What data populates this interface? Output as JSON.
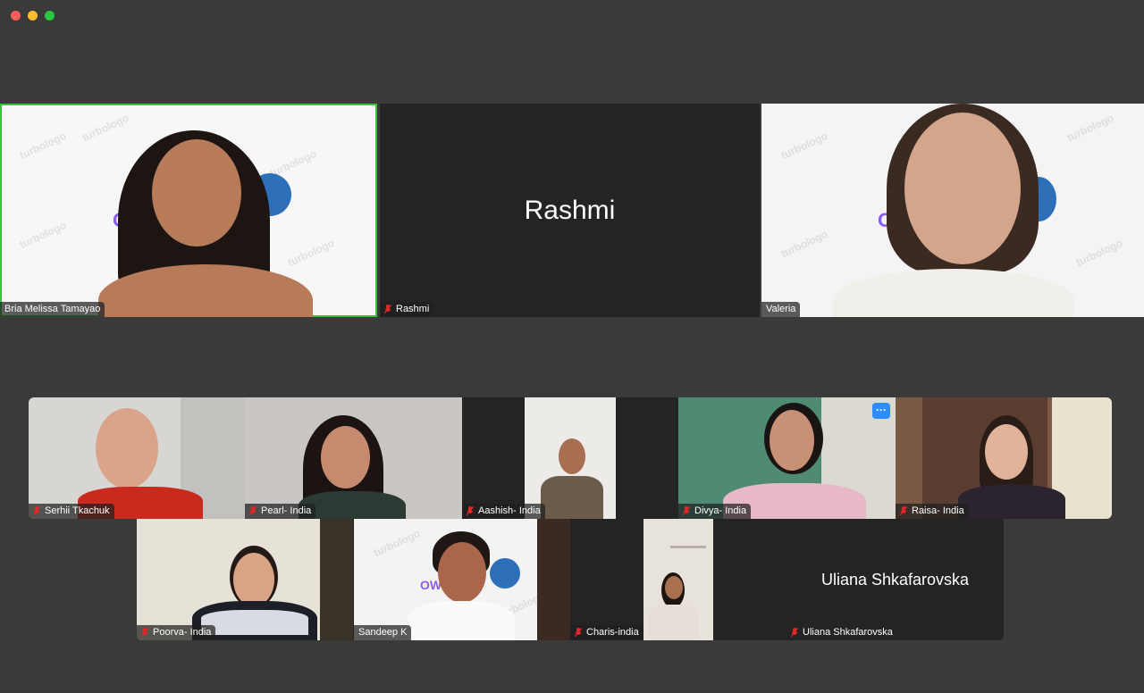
{
  "window": {
    "controls": {
      "close_color": "#ff5f57",
      "minimize_color": "#febc2e",
      "maximize_color": "#28c840"
    }
  },
  "top_row": [
    {
      "name": "Bria Melissa Tamayao",
      "muted": false,
      "speaking": true
    },
    {
      "name": "Rashmi",
      "muted": true,
      "camera_off": true,
      "display_name": "Rashmi"
    },
    {
      "name": "Valeria",
      "muted": false
    }
  ],
  "gallery_row1": [
    {
      "name": "Serhii Tkachuk",
      "muted": true
    },
    {
      "name": "Pearl- India",
      "muted": true
    },
    {
      "name": "Aashish- India",
      "muted": true
    },
    {
      "name": "Divya- India",
      "muted": true,
      "more_button": "···"
    },
    {
      "name": "Raisa- India",
      "muted": true
    }
  ],
  "gallery_row2": [
    {
      "name": "Poorva- India",
      "muted": true
    },
    {
      "name": "Sandeep K",
      "muted": false
    },
    {
      "name": "Charis-india",
      "muted": true
    },
    {
      "name": "Uliana Shkafarovska",
      "muted": true,
      "camera_off": true,
      "display_name": "Uliana Shkafarovska"
    }
  ],
  "brand": {
    "watermark": "turbologo",
    "logo_text": "OW"
  },
  "colors": {
    "accent_active": "#3cc13c",
    "mute_red": "#e02828",
    "more_button": "#2d8cff"
  }
}
